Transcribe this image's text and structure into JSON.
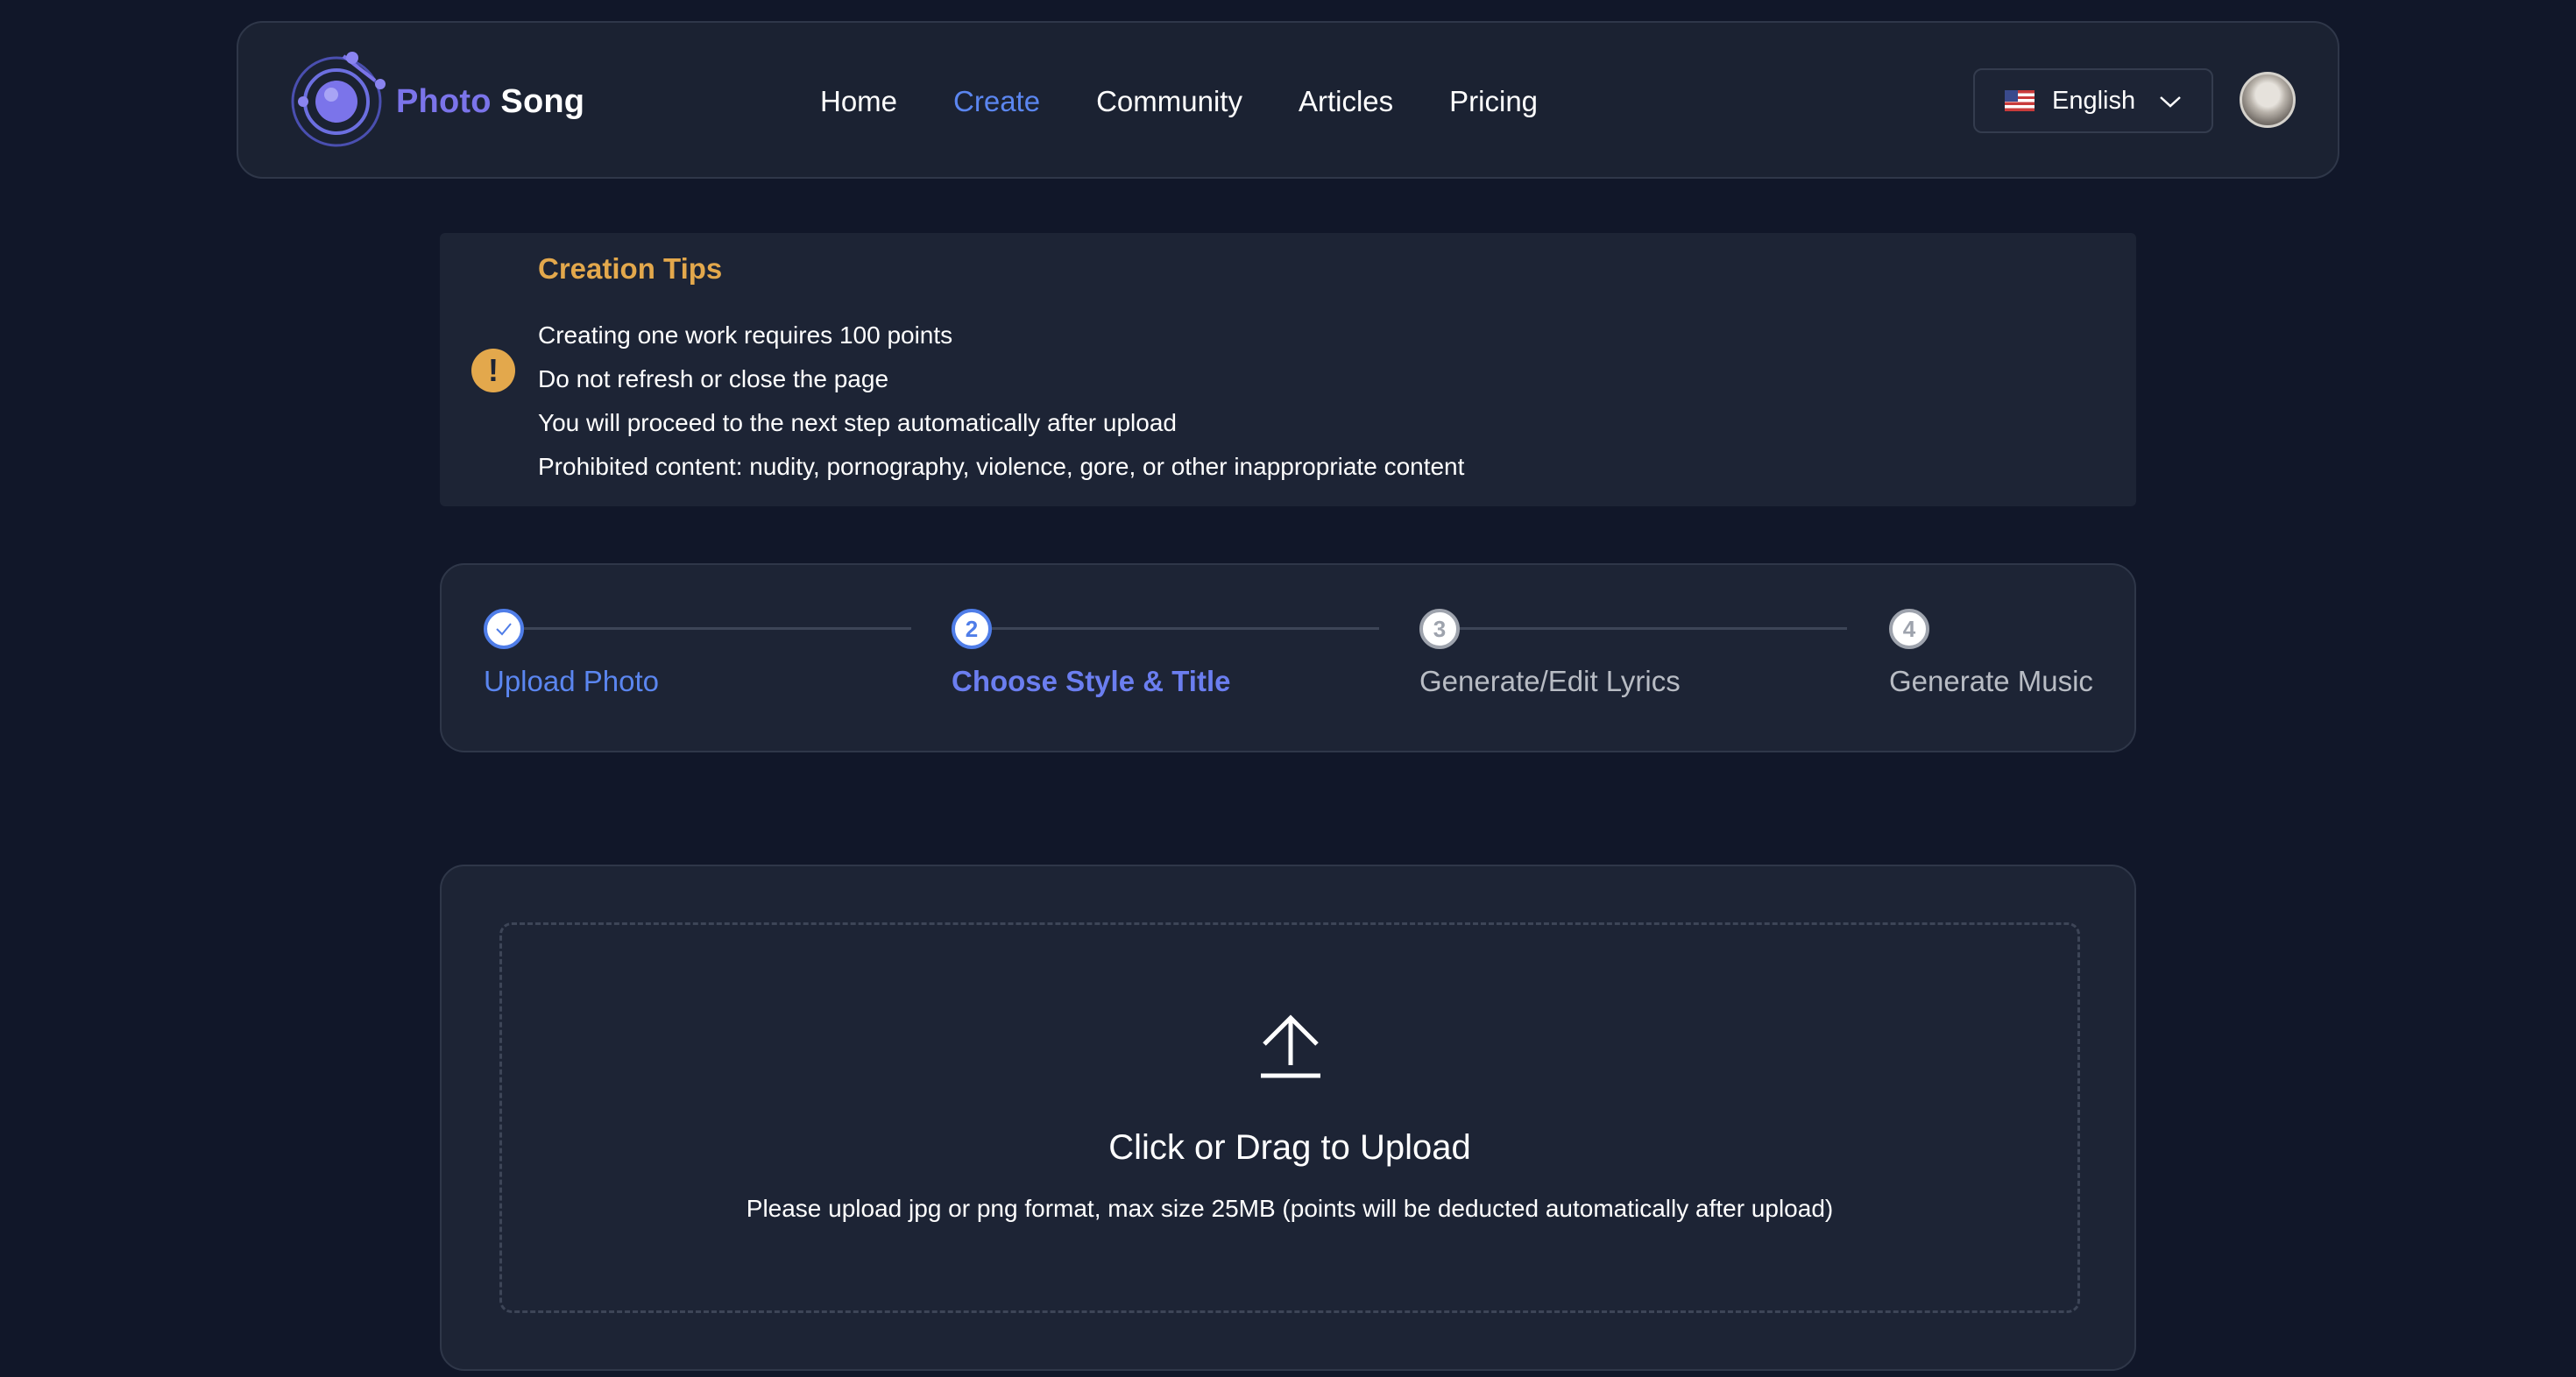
{
  "header": {
    "brand_part1": "Photo",
    "brand_part2": "Song",
    "nav": [
      "Home",
      "Create",
      "Community",
      "Articles",
      "Pricing"
    ],
    "active_nav": "Create",
    "language": "English"
  },
  "tips": {
    "title": "Creation Tips",
    "lines": [
      "Creating one work requires 100 points",
      "Do not refresh or close the page",
      "You will proceed to the next step automatically after upload",
      "Prohibited content: nudity, pornography, violence, gore, or other inappropriate content"
    ]
  },
  "steps": {
    "items": [
      {
        "number": "",
        "label": "Upload Photo",
        "state": "done"
      },
      {
        "number": "2",
        "label": "Choose Style & Title",
        "state": "current"
      },
      {
        "number": "3",
        "label": "Generate/Edit Lyrics",
        "state": "todo"
      },
      {
        "number": "4",
        "label": "Generate Music",
        "state": "todo"
      }
    ]
  },
  "upload": {
    "title": "Click or Drag to Upload",
    "hint": "Please upload jpg or png format, max size 25MB (points will be deducted automatically after upload)"
  },
  "colors": {
    "background": "#111729",
    "accent": "#5b86f0",
    "warning": "#e3a84c",
    "brand": "#7b74ea"
  },
  "icons": {
    "logo": "orbit-logo-icon",
    "warning": "exclamation-icon",
    "check": "check-icon",
    "upload": "upload-arrow-icon",
    "chevron": "chevron-down-icon",
    "flag": "us-flag-icon"
  }
}
